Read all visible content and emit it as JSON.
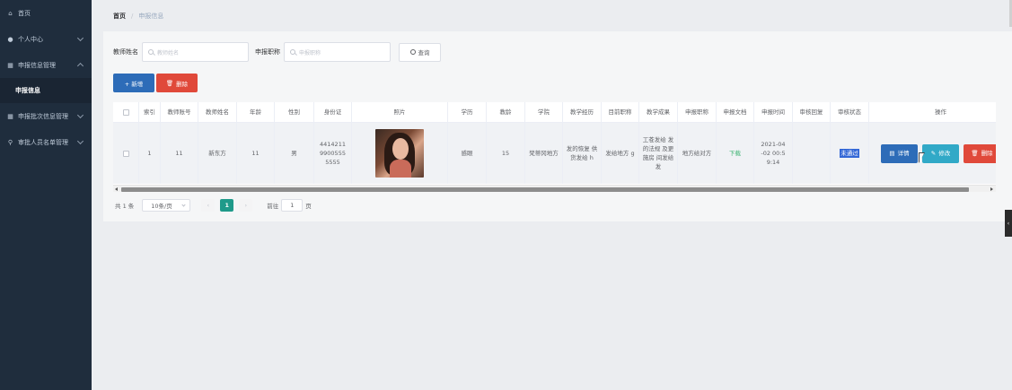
{
  "sidebar": {
    "items": [
      {
        "label": "首页",
        "icon": "home-icon",
        "expandable": false
      },
      {
        "label": "个人中心",
        "icon": "user-icon",
        "expandable": true,
        "expanded": false
      },
      {
        "label": "申报信息管理",
        "icon": "grid-icon",
        "expandable": true,
        "expanded": true
      },
      {
        "label": "申报批次信息管理",
        "icon": "grid-icon",
        "expandable": true,
        "expanded": false
      },
      {
        "label": "审批人员名单管理",
        "icon": "pin-icon",
        "expandable": true,
        "expanded": false
      }
    ],
    "sub_item": "申报信息"
  },
  "breadcrumb": {
    "home": "首页",
    "separator": "/",
    "current": "申报信息"
  },
  "search": {
    "teacher_name_label": "教师姓名",
    "teacher_name_placeholder": "教师姓名",
    "title_label": "申报职称",
    "title_placeholder": "申报职称",
    "query_button": "查询"
  },
  "actions": {
    "add": "+ 新增",
    "delete": "删除"
  },
  "table": {
    "columns": [
      "索引",
      "教师账号",
      "教师姓名",
      "年龄",
      "性别",
      "身份证",
      "照片",
      "学历",
      "教龄",
      "学院",
      "教学经历",
      "目前职称",
      "教学成果",
      "申报职称",
      "申报文档",
      "申报时间",
      "审核回复",
      "审核状态",
      "操作"
    ],
    "rows": [
      {
        "index": "1",
        "account": "11",
        "name": "新东方",
        "age": "11",
        "gender": "男",
        "id_card": "4414211 9900555 5555",
        "education": "感眼",
        "teaching_years": "15",
        "college": "梵蒂冈地方",
        "experience": "发的恢复 供货发给 h",
        "current_title": "发给地方 g",
        "achievements": "工苍发给 发的法规 及更施房 间发给发",
        "applied_title": "地方给对方",
        "document": "下载",
        "apply_time": "2021-04 -02 00:5 9:14",
        "reply": "",
        "status": "未通过",
        "ops": {
          "detail": "详情",
          "edit": "修改",
          "delete": "删除"
        }
      }
    ]
  },
  "pagination": {
    "total": "共 1 条",
    "page_size": "10条/页",
    "current_page": "1",
    "goto_label": "前往",
    "goto_value": "1",
    "page_unit": "页"
  },
  "colors": {
    "sidebar_bg": "#1f2d3d",
    "primary": "#2d6cb8",
    "danger": "#e0493a",
    "info": "#31a9c7",
    "pager_active": "#1f9a8a",
    "download_link": "#3cb371"
  }
}
